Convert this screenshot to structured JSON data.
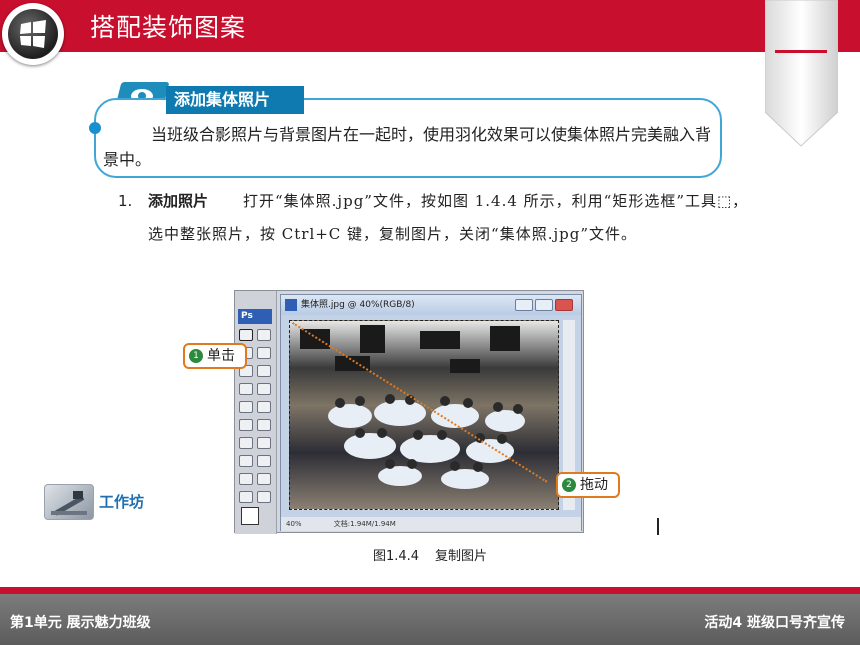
{
  "header": {
    "title": "搭配装饰图案"
  },
  "section": {
    "title": "添加集体照片"
  },
  "callout": {
    "text": "当班级合影照片与背景图片在一起时，使用羽化效果可以使集体照片完美融入背景中。"
  },
  "step": {
    "number": "1.",
    "heading": "添加照片",
    "body": "打开“集体照.jpg”文件，按如图 1.4.4 所示，利用“矩形选框”工具⬚，选中整张照片，按 Ctrl+C 键，复制图片，关闭“集体照.jpg”文件。"
  },
  "figure": {
    "window_title": "集体照.jpg @ 40%(RGB/8)",
    "app_logo": "Ps",
    "status_zoom": "40%",
    "status_doc": "文档:1.94M/1.94M",
    "bubble_click_num": "1",
    "bubble_click": "单击",
    "bubble_drag_num": "2",
    "bubble_drag": "拖动",
    "caption_number": "图1.4.4",
    "caption_text": "复制图片"
  },
  "workshop": {
    "label": "工作坊"
  },
  "footer": {
    "left": "第1单元  展示魅力班级",
    "right": "活动4  班级口号齐宣传"
  },
  "colors": {
    "brand_red": "#c8102e",
    "accent_blue": "#0f7ab0",
    "bubble_orange": "#e07a1f"
  },
  "icons": {
    "logo": "windows-logo-icon",
    "section": "eye-icon",
    "workshop": "tools-icon"
  }
}
